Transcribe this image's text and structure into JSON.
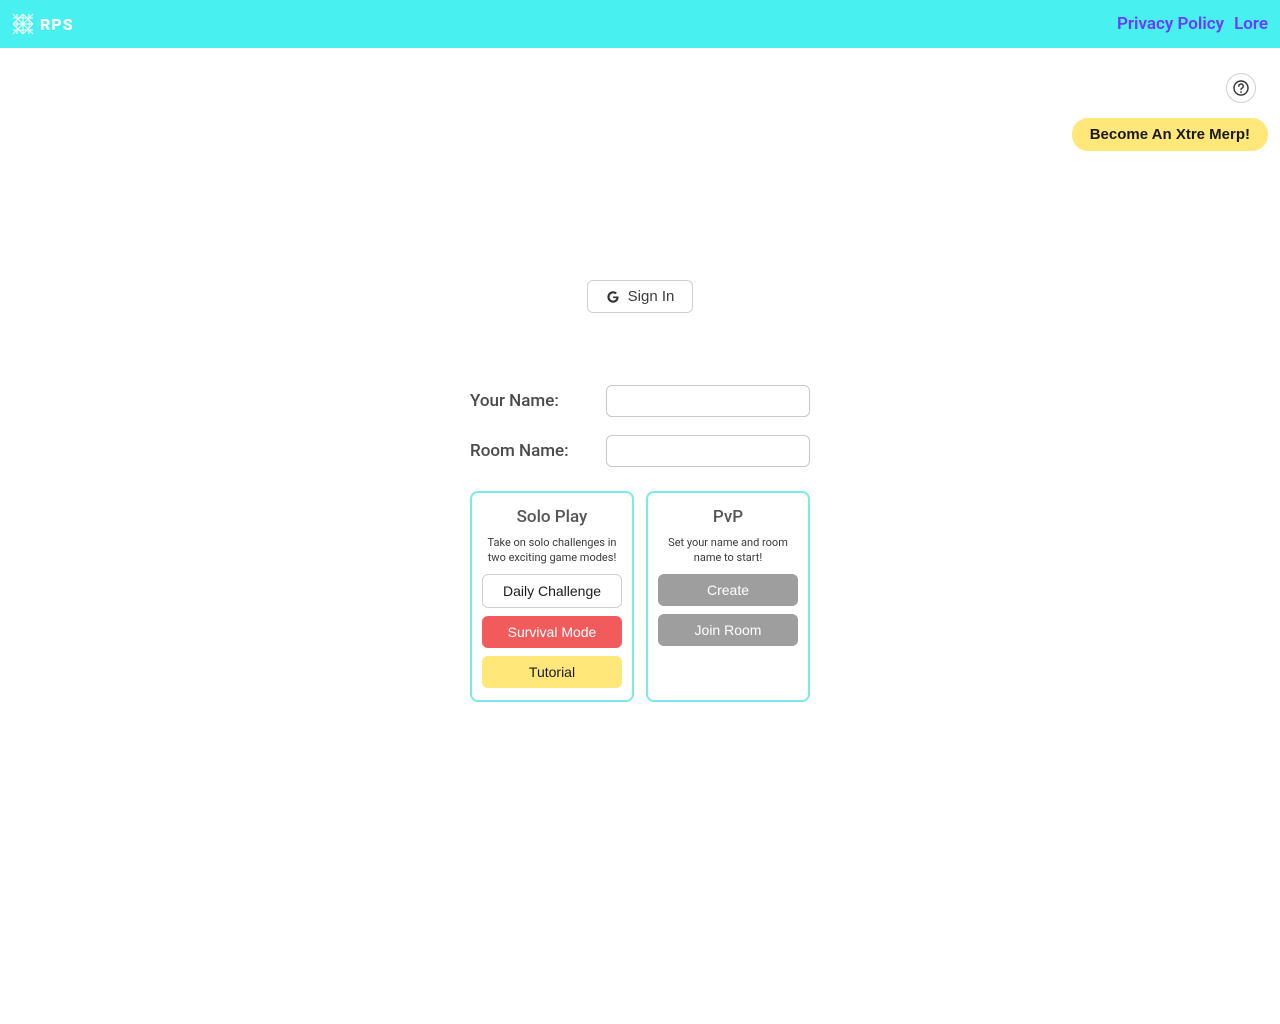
{
  "header": {
    "logo_text": "RPS",
    "links": {
      "privacy": "Privacy Policy",
      "lore": "Lore"
    }
  },
  "top": {
    "merp_label": "Become An Xtre Merp!"
  },
  "signin": {
    "label": "Sign In"
  },
  "fields": {
    "name_label": "Your Name:",
    "room_label": "Room Name:",
    "name_value": "",
    "room_value": ""
  },
  "solo": {
    "title": "Solo Play",
    "desc": "Take on solo challenges in two exciting game modes!",
    "daily": "Daily Challenge",
    "survival": "Survival Mode",
    "tutorial": "Tutorial"
  },
  "pvp": {
    "title": "PvP",
    "desc": "Set your name and room name to start!",
    "create": "Create",
    "join": "Join Room"
  }
}
